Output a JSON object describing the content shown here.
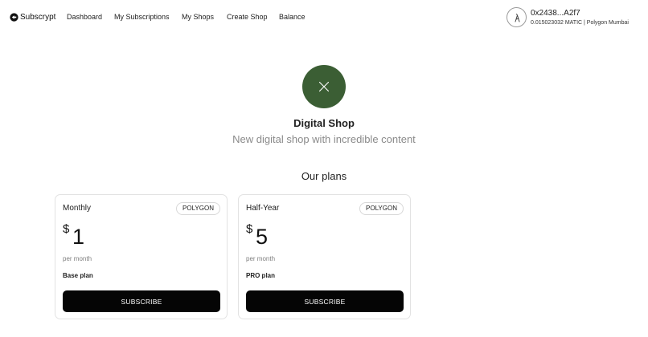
{
  "nav": {
    "brand": "Subscrypt",
    "links": [
      "Dashboard",
      "My Subscriptions",
      "My Shops",
      "Create Shop",
      "Balance"
    ]
  },
  "account": {
    "address": "0x2438...A2f7",
    "balance": "0.015023032 MATIC | Polygon Mumbai"
  },
  "shop": {
    "title": "Digital Shop",
    "description": "New digital shop with incredible content",
    "logo_color": "#3b5e34"
  },
  "plans_title": "Our plans",
  "plans": [
    {
      "name": "Monthly",
      "network": "POLYGON",
      "currency": "$",
      "price": "1",
      "period": "per month",
      "description": "Base plan",
      "button": "SUBSCRIBE"
    },
    {
      "name": "Half-Year",
      "network": "POLYGON",
      "currency": "$",
      "price": "5",
      "period": "per month",
      "description": "PRO plan",
      "button": "SUBSCRIBE"
    }
  ]
}
